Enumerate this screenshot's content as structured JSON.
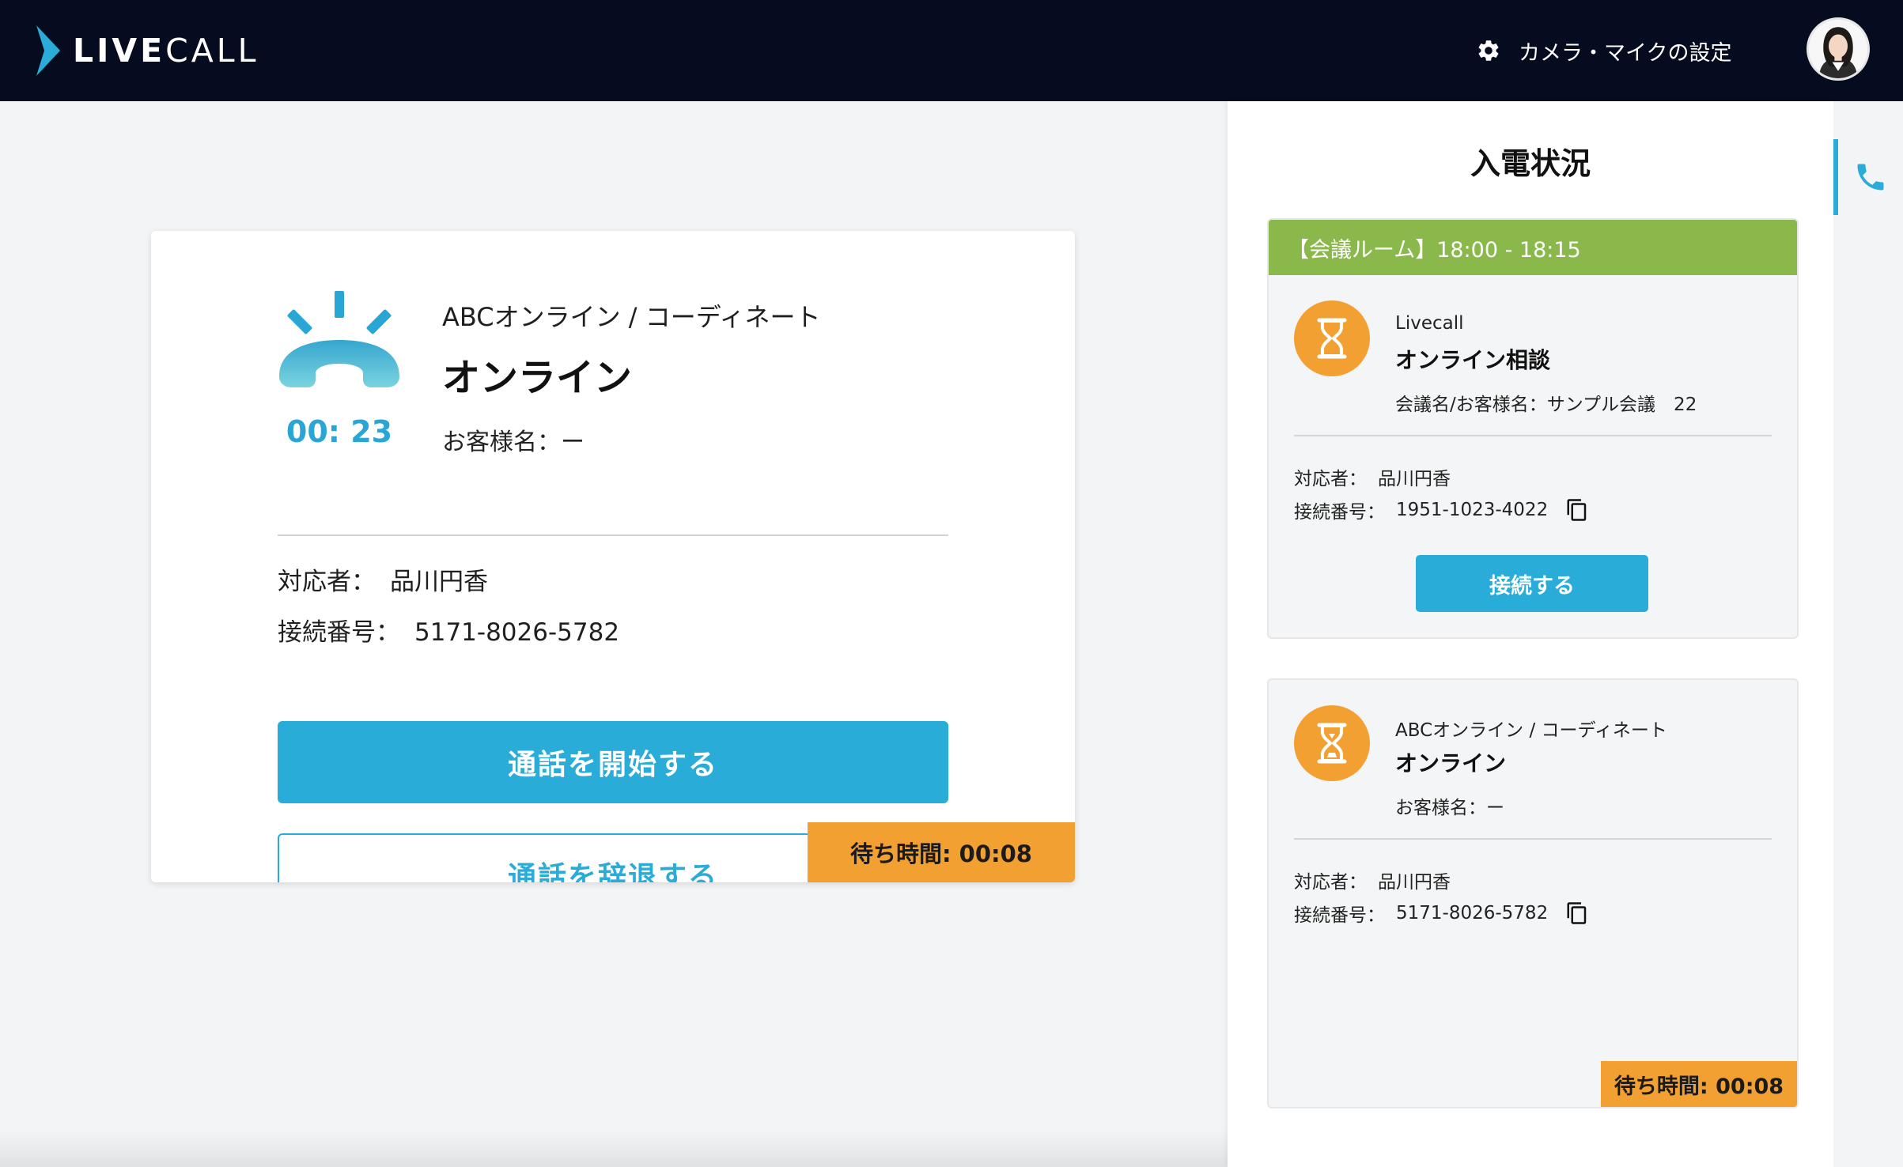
{
  "header": {
    "logo_text_bold": "LIVE",
    "logo_text_light": "CALL",
    "settings_label": "カメラ・マイクの設定",
    "settings_icon": "gear-icon",
    "avatar": "user-avatar"
  },
  "main_card": {
    "timer": "00: 23",
    "company": "ABCオンライン / コーディネート",
    "title": "オンライン",
    "customer": "お客様名：ー",
    "responder_label": "対応者：",
    "responder_value": "品川円香",
    "connection_label": "接続番号：",
    "connection_value": "5171-8026-5782",
    "start_button": "通話を開始する",
    "decline_button": "通話を辞退する",
    "wait_time": "待ち時間: 00:08"
  },
  "panel": {
    "title": "入電状況",
    "cards": [
      {
        "header": "【会議ルーム】18:00 - 18:15",
        "company": "Livecall",
        "title": "オンライン相談",
        "sub": "会議名/お客様名：サンプル会議　22",
        "responder_label": "対応者：",
        "responder_value": "品川円香",
        "connection_label": "接続番号：",
        "connection_value": "1951-1023-4022",
        "connect_button": "接続する"
      },
      {
        "company": "ABCオンライン / コーディネート",
        "title": "オンライン",
        "sub": "お客様名：ー",
        "responder_label": "対応者：",
        "responder_value": "品川円香",
        "connection_label": "接続番号：",
        "connection_value": "5171-8026-5782",
        "wait_time": "待ち時間: 00:08"
      }
    ]
  },
  "colors": {
    "header_bg": "#060c1f",
    "accent": "#2aacd8",
    "wait": "#f3a033",
    "room_header": "#8bb84a"
  }
}
